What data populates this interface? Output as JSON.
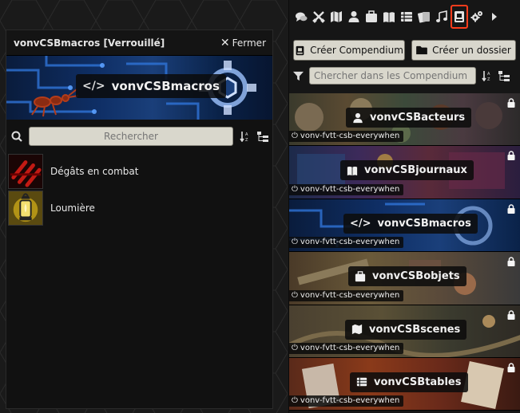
{
  "window": {
    "title": "vonvCSBmacros [Verrouillé]",
    "close_label": "Fermer",
    "banner_label": "vonvCSBmacros",
    "search_placeholder": "Rechercher",
    "entries": [
      {
        "label": "Dégâts en combat",
        "icon": "claw-slash-icon"
      },
      {
        "label": "Loumière",
        "icon": "lantern-icon"
      }
    ]
  },
  "sidebar": {
    "tabs": [
      {
        "name": "chat",
        "icon": "chat-bubbles-icon"
      },
      {
        "name": "combat",
        "icon": "crossed-swords-icon"
      },
      {
        "name": "scenes",
        "icon": "map-icon"
      },
      {
        "name": "actors",
        "icon": "user-icon"
      },
      {
        "name": "items",
        "icon": "suitcase-icon"
      },
      {
        "name": "journal",
        "icon": "book-open-icon"
      },
      {
        "name": "tables",
        "icon": "table-list-icon"
      },
      {
        "name": "cards",
        "icon": "cards-icon"
      },
      {
        "name": "playlists",
        "icon": "music-icon"
      },
      {
        "name": "compendium",
        "icon": "atlas-icon",
        "active": true
      },
      {
        "name": "settings",
        "icon": "cogs-icon"
      },
      {
        "name": "collapse",
        "icon": "caret-right-icon"
      }
    ],
    "create_compendium_label": "Créer Compendium",
    "create_folder_label": "Créer un dossier",
    "filter_placeholder": "Chercher dans les Compendium",
    "packs": [
      {
        "label": "vonvCSBacteurs",
        "source": "vonv-fvtt-csb-everywhen",
        "icon": "user-icon"
      },
      {
        "label": "vonvCSBjournaux",
        "source": "vonv-fvtt-csb-everywhen",
        "icon": "book-open-icon"
      },
      {
        "label": "vonvCSBmacros",
        "source": "vonv-fvtt-csb-everywhen",
        "icon": "code-icon"
      },
      {
        "label": "vonvCSBobjets",
        "source": "vonv-fvtt-csb-everywhen",
        "icon": "suitcase-icon"
      },
      {
        "label": "vonvCSBscenes",
        "source": "vonv-fvtt-csb-everywhen",
        "icon": "map-icon"
      },
      {
        "label": "vonvCSBtables",
        "source": "vonv-fvtt-csb-everywhen",
        "icon": "table-list-icon"
      }
    ]
  },
  "colors": {
    "active_tab_border": "#ff3c1c",
    "button_bg": "#d8d6cc"
  }
}
